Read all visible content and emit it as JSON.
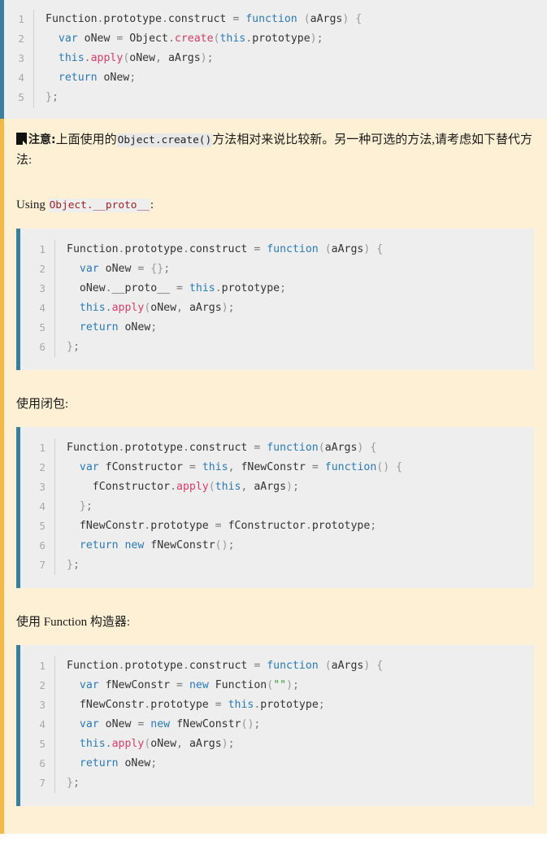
{
  "colors": {
    "code_bg": "#eeeeee",
    "code_border": "#3b7f9e",
    "note_bg": "#fdf0d5",
    "note_border": "#f5ba45",
    "keyword": "#2a7ab9",
    "method": "#d83d6a",
    "string": "#3d9c35",
    "punctuation": "#999999",
    "inline_code_red": "#a32222",
    "gutter_text": "#a8a8a8"
  },
  "top_code_block": {
    "name": "object-create-construct",
    "line_numbers": [
      "1",
      "2",
      "3",
      "4",
      "5"
    ],
    "lines": [
      "Function.prototype.construct = function (aArgs) {",
      "  var oNew = Object.create(this.prototype);",
      "  this.apply(oNew, aArgs);",
      "  return oNew;",
      "};"
    ]
  },
  "note": {
    "icon": "note-dogear-icon",
    "label": "注意:",
    "text_before_code": "上面使用的",
    "inline_code": "Object.create()",
    "text_after_code": "方法相对来说比较新。另一种可选的方法,请考虑如下替代方法:",
    "sections": [
      {
        "heading_prefix": "Using ",
        "heading_code": "Object.__proto__",
        "heading_suffix": ":",
        "heading_plain": "",
        "code": {
          "name": "proto-construct",
          "line_numbers": [
            "1",
            "2",
            "3",
            "4",
            "5",
            "6"
          ],
          "lines": [
            "Function.prototype.construct = function (aArgs) {",
            "  var oNew = {};",
            "  oNew.__proto__ = this.prototype;",
            "  this.apply(oNew, aArgs);",
            "  return oNew;",
            "};"
          ]
        }
      },
      {
        "heading_prefix": "",
        "heading_code": "",
        "heading_suffix": "",
        "heading_plain": "使用闭包:",
        "code": {
          "name": "closure-construct",
          "line_numbers": [
            "1",
            "2",
            "3",
            "4",
            "5",
            "6",
            "7"
          ],
          "lines": [
            "Function.prototype.construct = function(aArgs) {",
            "  var fConstructor = this, fNewConstr = function() {",
            "    fConstructor.apply(this, aArgs);",
            "  };",
            "  fNewConstr.prototype = fConstructor.prototype;",
            "  return new fNewConstr();",
            "};"
          ]
        }
      },
      {
        "heading_prefix": "",
        "heading_code": "",
        "heading_suffix": "",
        "heading_plain": "使用 Function 构造器:",
        "code": {
          "name": "function-constructor-construct",
          "line_numbers": [
            "1",
            "2",
            "3",
            "4",
            "5",
            "6",
            "7"
          ],
          "lines": [
            "Function.prototype.construct = function (aArgs) {",
            "  var fNewConstr = new Function(\"\");",
            "  fNewConstr.prototype = this.prototype;",
            "  var oNew = new fNewConstr();",
            "  this.apply(oNew, aArgs);",
            "  return oNew;",
            "};"
          ]
        }
      }
    ]
  }
}
